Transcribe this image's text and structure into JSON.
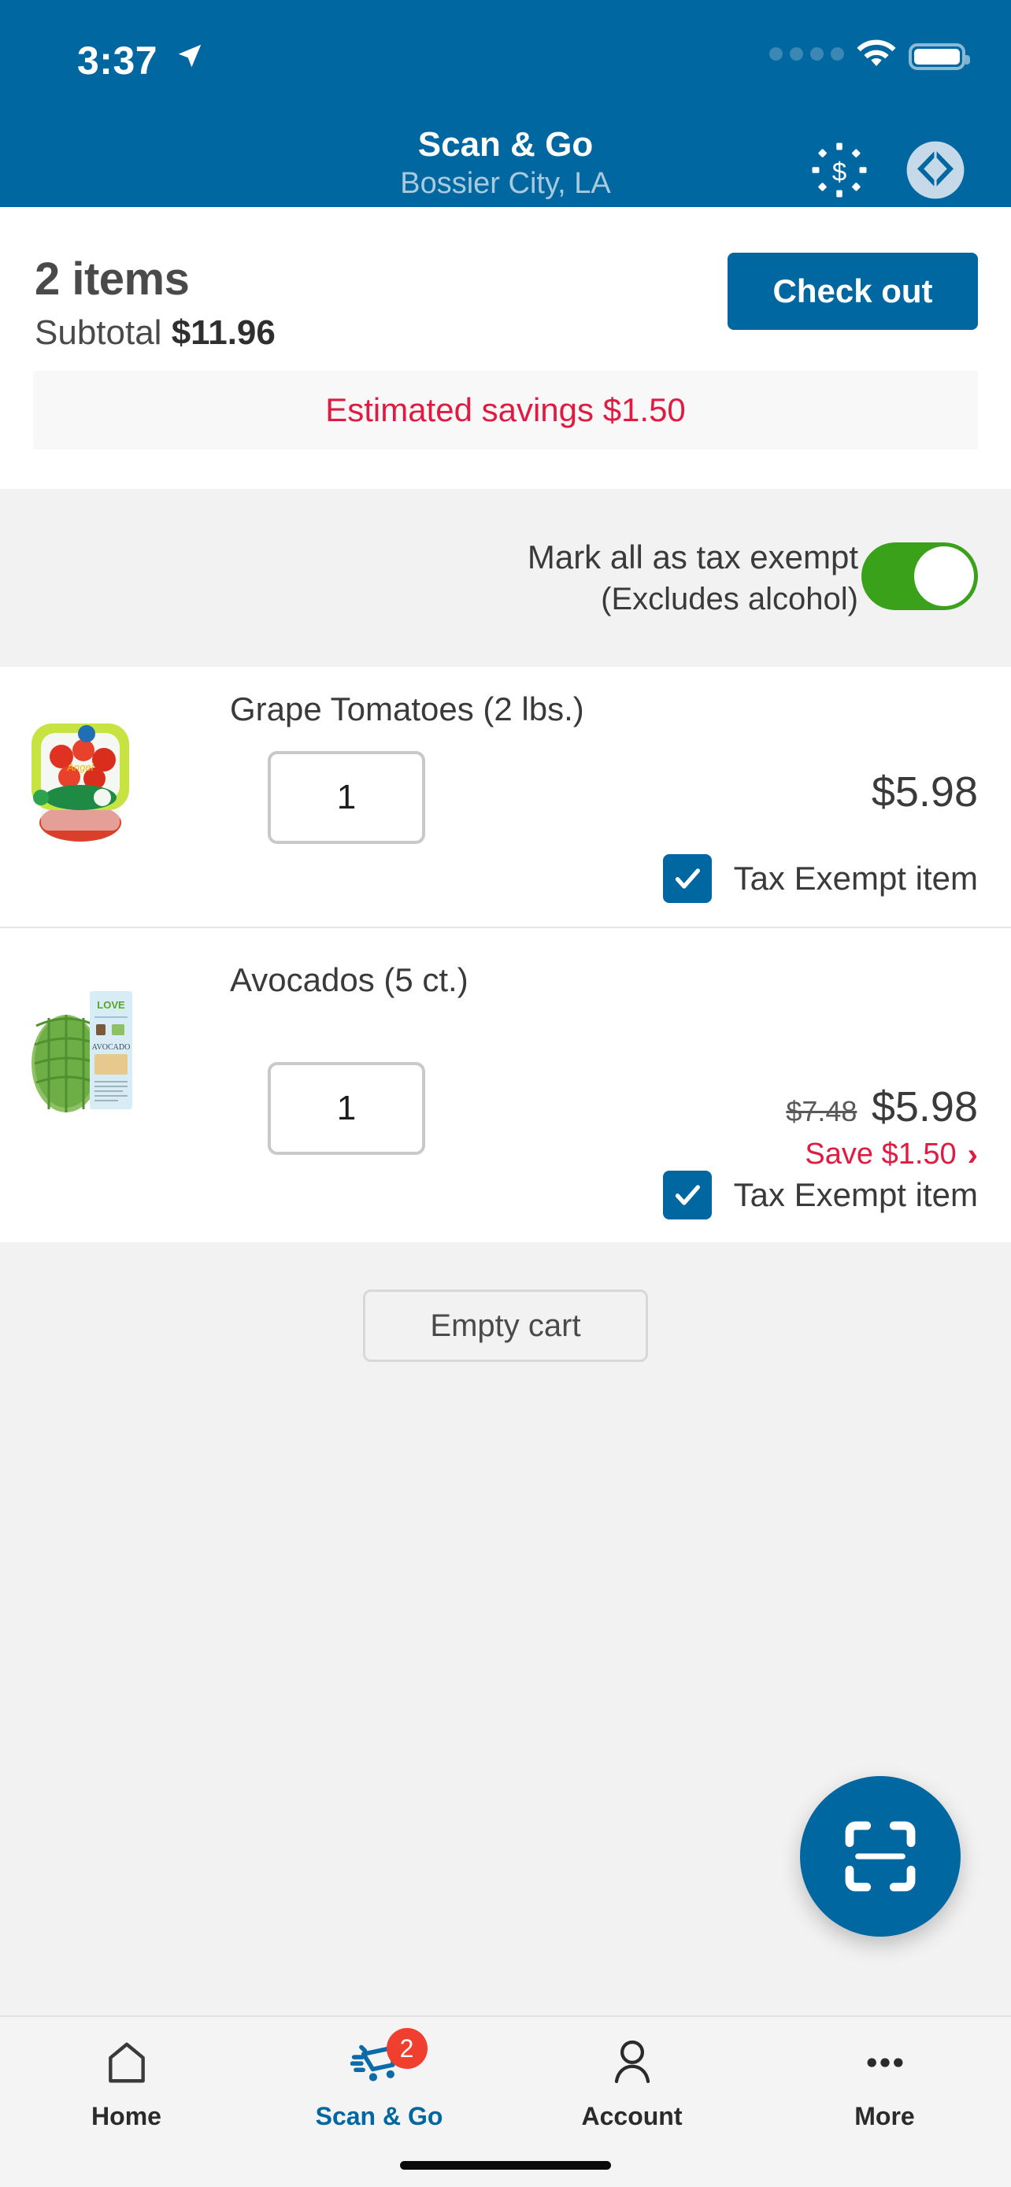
{
  "status_bar": {
    "time": "3:37",
    "location_icon": "location-arrow-icon",
    "signal_icon": "signal-dots-icon",
    "wifi_icon": "wifi-icon",
    "battery_icon": "battery-full-icon"
  },
  "header": {
    "title": "Scan & Go",
    "subtitle": "Bossier City, LA",
    "savings_icon": "dollar-savings-icon",
    "logo_icon": "sams-club-diamond-logo-icon",
    "background_color": "#0067a0"
  },
  "summary": {
    "item_count_label": "2 items",
    "subtotal_label": "Subtotal",
    "subtotal_value": "$11.96",
    "checkout_label": "Check out",
    "estimated_savings_label": "Estimated savings",
    "estimated_savings_value": "$1.50",
    "savings_color": "#e01a41"
  },
  "tax_exempt_all": {
    "line1": "Mark all as tax exempt",
    "line2": "(Excludes alcohol)",
    "toggle_state": "on",
    "toggle_color": "#3aa11a"
  },
  "items": [
    {
      "name": "Grape Tomatoes (2 lbs.)",
      "quantity": "1",
      "price": "$5.98",
      "was_price": "",
      "save_text": "",
      "tax_exempt_label": "Tax Exempt item",
      "tax_exempt_checked": true,
      "thumb_icon": "grape-tomatoes-package-image"
    },
    {
      "name": "Avocados (5 ct.)",
      "quantity": "1",
      "price": "$5.98",
      "was_price": "$7.48",
      "save_text": "Save $1.50",
      "tax_exempt_label": "Tax Exempt item",
      "tax_exempt_checked": true,
      "thumb_icon": "avocados-mesh-bag-image"
    }
  ],
  "empty_cart_label": "Empty cart",
  "scan_fab": {
    "icon": "scan-barcode-icon",
    "color": "#0067a0"
  },
  "tabbar": {
    "tabs": [
      {
        "label": "Home",
        "icon": "home-icon",
        "active": false,
        "badge": ""
      },
      {
        "label": "Scan & Go",
        "icon": "scan-cart-icon",
        "active": true,
        "badge": "2"
      },
      {
        "label": "Account",
        "icon": "person-icon",
        "active": false,
        "badge": ""
      },
      {
        "label": "More",
        "icon": "ellipsis-icon",
        "active": false,
        "badge": ""
      }
    ],
    "active_color": "#0067a0",
    "badge_color": "#f03e2f"
  }
}
